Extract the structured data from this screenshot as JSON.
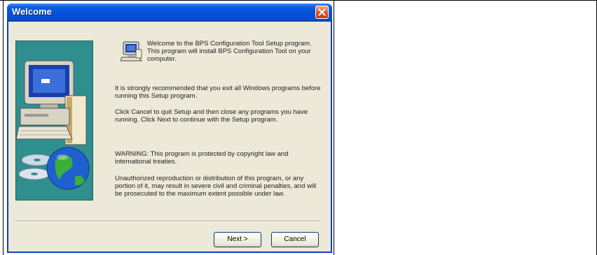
{
  "window": {
    "title": "Welcome",
    "close_icon": "close-icon"
  },
  "body": {
    "intro": "Welcome to the BPS Configuration Tool Setup program.  This program will install BPS Configuration Tool on your computer.",
    "recommend": "It is strongly recommended that you exit all Windows programs before running this Setup program.",
    "cancel_info": "Click Cancel to quit Setup and then close any programs you have running.  Click Next to continue with the Setup program.",
    "warning": "WARNING: This program is protected by copyright law and international treaties.",
    "unauthorized": "Unauthorized reproduction or distribution of this program, or any portion of it, may result in severe civil and criminal penalties, and will be prosecuted to the maximum extent possible under law."
  },
  "buttons": {
    "next": "Next >",
    "cancel": "Cancel"
  },
  "colors": {
    "titlebar": "#0350d8",
    "dialog_bg": "#ece9d8",
    "art_panel": "#2f8f8f",
    "close_button": "#e04a1c"
  }
}
